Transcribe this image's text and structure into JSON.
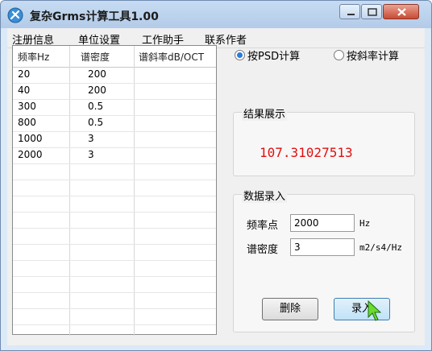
{
  "window": {
    "title": "复杂Grms计算工具1.00"
  },
  "menu": [
    "注册信息",
    "单位设置",
    "工作助手",
    "联系作者"
  ],
  "table": {
    "headers": [
      "频率Hz",
      "谱密度",
      "谱斜率dB/OCT"
    ],
    "rows": [
      [
        "20",
        "200",
        ""
      ],
      [
        "40",
        "200",
        ""
      ],
      [
        "300",
        "0.5",
        ""
      ],
      [
        "800",
        "0.5",
        ""
      ],
      [
        "1000",
        "3",
        ""
      ],
      [
        "2000",
        "3",
        ""
      ]
    ]
  },
  "mode": {
    "psd_label": "按PSD计算",
    "slope_label": "按斜率计算",
    "selected": "psd"
  },
  "result": {
    "group_title": "结果展示",
    "value": "107.31027513"
  },
  "entry": {
    "group_title": "数据录入",
    "freq_label": "频率点",
    "freq_value": "2000",
    "freq_unit": "Hz",
    "psd_label": "谱密度",
    "psd_value": "3",
    "psd_unit": "m2/s4/Hz",
    "delete_label": "删除",
    "enter_label": "录入"
  },
  "colors": {
    "result": "#e01010",
    "accent": "#2a7be0"
  }
}
